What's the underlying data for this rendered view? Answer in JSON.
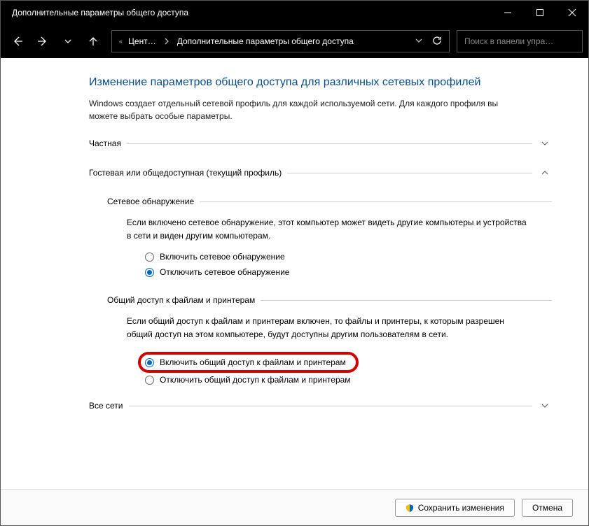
{
  "window": {
    "title": "Дополнительные параметры общего доступа"
  },
  "breadcrumb": {
    "segment1": "Цент…",
    "segment2": "Дополнительные параметры общего доступа"
  },
  "search": {
    "placeholder": "Поиск в панели упра…"
  },
  "page": {
    "title": "Изменение параметров общего доступа для различных сетевых профилей",
    "desc": "Windows создает отдельный сетевой профиль для каждой используемой сети. Для каждого профиля вы можете выбрать особые параметры."
  },
  "sections": {
    "private": {
      "label": "Частная"
    },
    "guest": {
      "label": "Гостевая или общедоступная (текущий профиль)",
      "discovery": {
        "label": "Сетевое обнаружение",
        "desc": "Если включено сетевое обнаружение, этот компьютер может видеть другие компьютеры и устройства в сети и виден другим компьютерам.",
        "opt_on": "Включить сетевое обнаружение",
        "opt_off": "Отключить сетевое обнаружение"
      },
      "sharing": {
        "label": "Общий доступ к файлам и принтерам",
        "desc": "Если общий доступ к файлам и принтерам включен, то файлы и принтеры, к которым разрешен общий доступ на этом компьютере, будут доступны другим пользователям в сети.",
        "opt_on": "Включить общий доступ к файлам и принтерам",
        "opt_off": "Отключить общий доступ к файлам и принтерам"
      }
    },
    "all": {
      "label": "Все сети"
    }
  },
  "footer": {
    "save": "Сохранить изменения",
    "cancel": "Отмена"
  }
}
